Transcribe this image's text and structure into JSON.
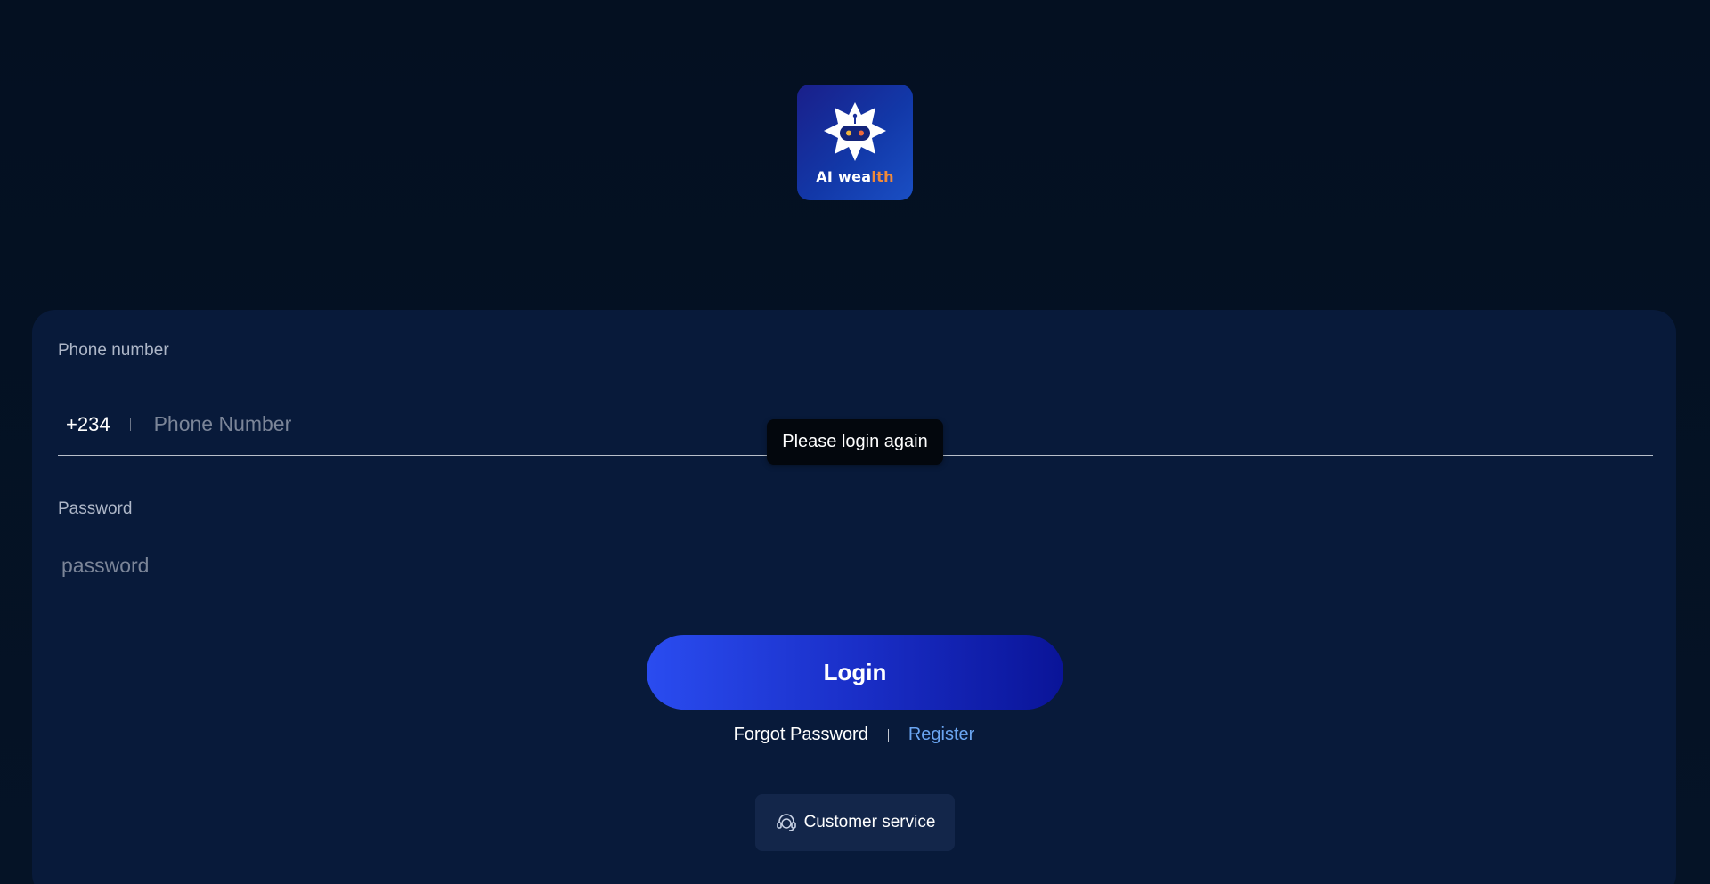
{
  "logo": {
    "text_main": "AI wea",
    "text_accent": "lth"
  },
  "form": {
    "phone_label": "Phone number",
    "country_code": "+234",
    "phone_placeholder": "Phone Number",
    "password_label": "Password",
    "password_placeholder": "password",
    "login_label": "Login"
  },
  "links": {
    "forgot_password": "Forgot Password",
    "register": "Register"
  },
  "support": {
    "label": "Customer service",
    "icon": "headset-icon"
  },
  "toast": {
    "message": "Please login again"
  },
  "colors": {
    "background": "#04101f",
    "card": "#081a3a",
    "accent_link": "#6ba6f2",
    "logo_accent": "#f08a3a"
  }
}
